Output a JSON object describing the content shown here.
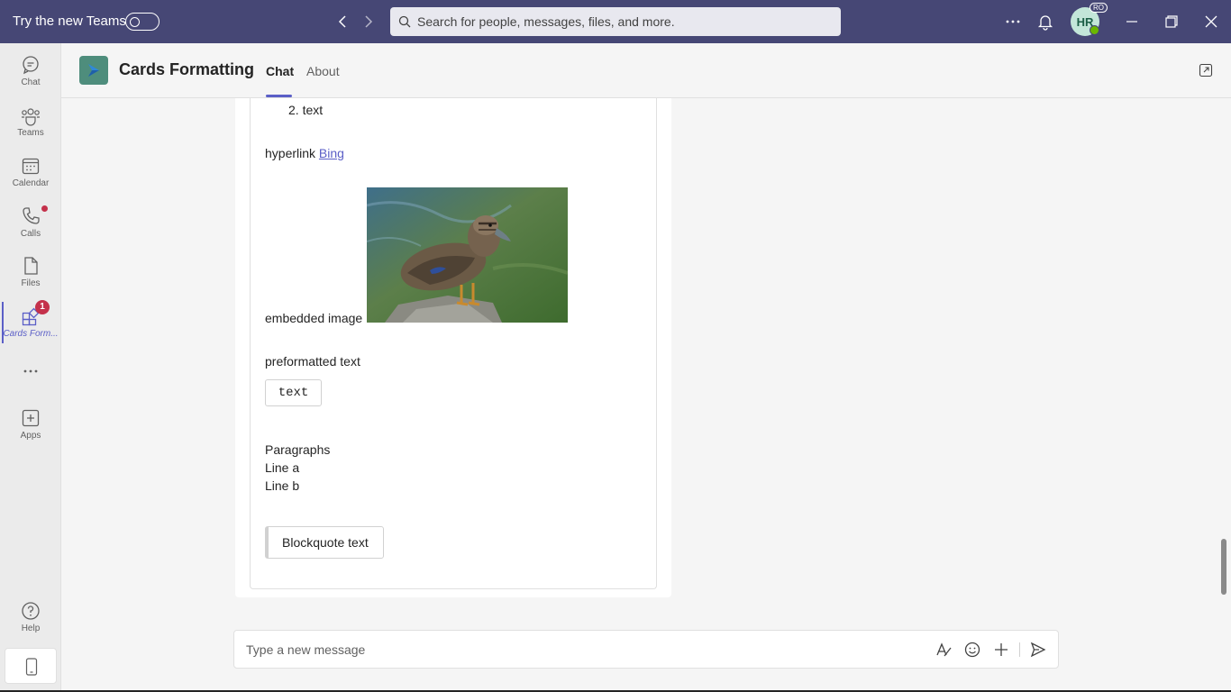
{
  "titlebar": {
    "try_new_label": "Try the new Teams",
    "search_placeholder": "Search for people, messages, files, and more.",
    "avatar_initials": "HR",
    "org_badge": "RO"
  },
  "rail": {
    "items": [
      {
        "label": "Chat"
      },
      {
        "label": "Teams"
      },
      {
        "label": "Calendar"
      },
      {
        "label": "Calls"
      },
      {
        "label": "Files"
      },
      {
        "label": "Cards Form...",
        "badge": "1"
      },
      {
        "label": "Apps"
      },
      {
        "label": "Help"
      }
    ]
  },
  "header": {
    "app_title": "Cards Formatting",
    "tabs": [
      {
        "label": "Chat"
      },
      {
        "label": "About"
      }
    ]
  },
  "card": {
    "list_item": "2. text",
    "hyperlink_label": "hyperlink",
    "hyperlink_text": "Bing",
    "embedded_image_label": "embedded image",
    "preformatted_label": "preformatted text",
    "preformatted_value": "text",
    "paragraphs_heading": "Paragraphs",
    "line_a": "Line a",
    "line_b": "Line b",
    "blockquote": "Blockquote text"
  },
  "compose": {
    "placeholder": "Type a new message"
  },
  "colors": {
    "titlebar": "#464775",
    "accent": "#5b5fc7",
    "badge": "#c4314b",
    "presence": "#6bb700"
  }
}
